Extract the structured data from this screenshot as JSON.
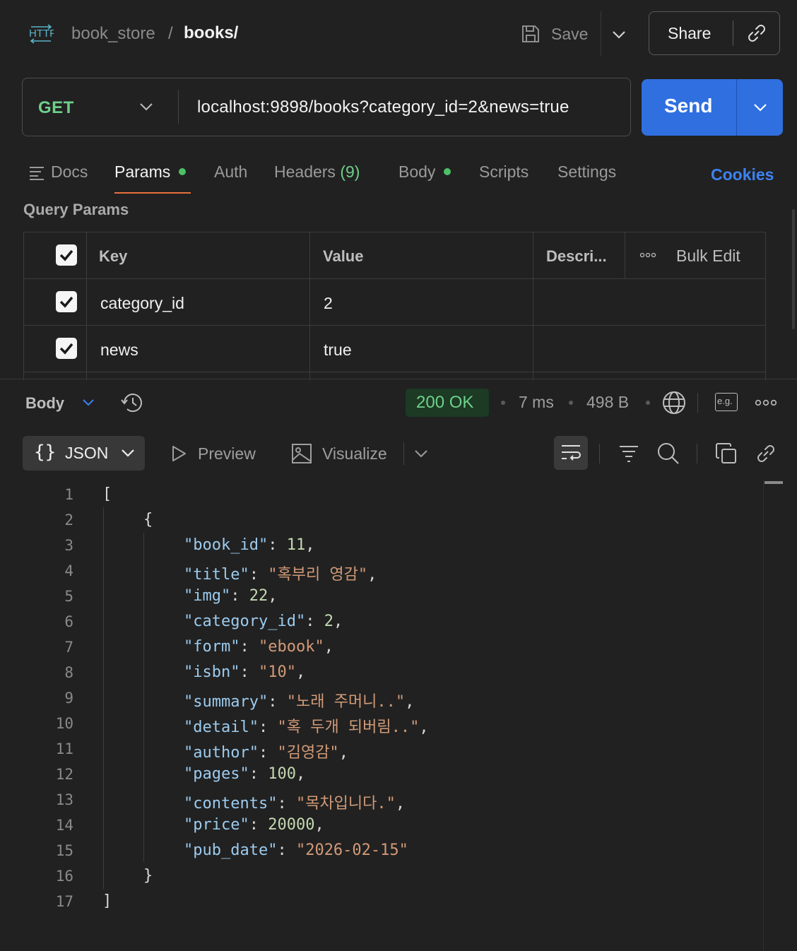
{
  "header": {
    "protocol_badge": "HTTP",
    "collection": "book_store",
    "separator": "/",
    "request_name": "books/",
    "save_label": "Save",
    "share_label": "Share"
  },
  "request": {
    "method": "GET",
    "url": "localhost:9898/books?category_id=2&news=true",
    "send_label": "Send"
  },
  "tabs": {
    "docs": "Docs",
    "params": "Params",
    "auth": "Auth",
    "headers": "Headers",
    "headers_count": "(9)",
    "body": "Body",
    "scripts": "Scripts",
    "settings": "Settings",
    "cookies": "Cookies"
  },
  "query_params": {
    "title": "Query Params",
    "columns": {
      "key": "Key",
      "value": "Value",
      "description": "Descri...",
      "bulk_edit": "Bulk Edit"
    },
    "rows": [
      {
        "key": "category_id",
        "value": "2",
        "checked": true
      },
      {
        "key": "news",
        "value": "true",
        "checked": true
      }
    ]
  },
  "response": {
    "body_label": "Body",
    "status": "200 OK",
    "time": "7 ms",
    "size": "498 B",
    "example_badge": "e.g.",
    "view_format": "JSON",
    "preview_label": "Preview",
    "visualize_label": "Visualize",
    "line_numbers": [
      "1",
      "2",
      "3",
      "4",
      "5",
      "6",
      "7",
      "8",
      "9",
      "10",
      "11",
      "12",
      "13",
      "14",
      "15",
      "16",
      "17"
    ],
    "json": {
      "book_id": "11",
      "title": "\"혹부리 영감\"",
      "img": "22",
      "category_id": "2",
      "form": "\"ebook\"",
      "isbn": "\"10\"",
      "summary": "\"노래 주머니..\"",
      "detail": "\"혹 두개 되버림..\"",
      "author": "\"김영감\"",
      "pages": "100",
      "contents": "\"목차입니다.\"",
      "price": "20000",
      "pub_date": "\"2026-02-15\""
    }
  },
  "colors": {
    "accent_send": "#2f6fe0",
    "method_get": "#6fcf8a",
    "tab_underline": "#e8703a",
    "status_ok": "#6fd08a",
    "cookies_link": "#3d82f2"
  },
  "icons": [
    "http-icon",
    "save-icon",
    "chevron-down-icon",
    "link-icon",
    "docs-icon",
    "more-icon",
    "history-icon",
    "globe-icon",
    "play-icon",
    "image-icon",
    "wrap-icon",
    "filter-icon",
    "search-icon",
    "copy-icon",
    "link-icon"
  ]
}
